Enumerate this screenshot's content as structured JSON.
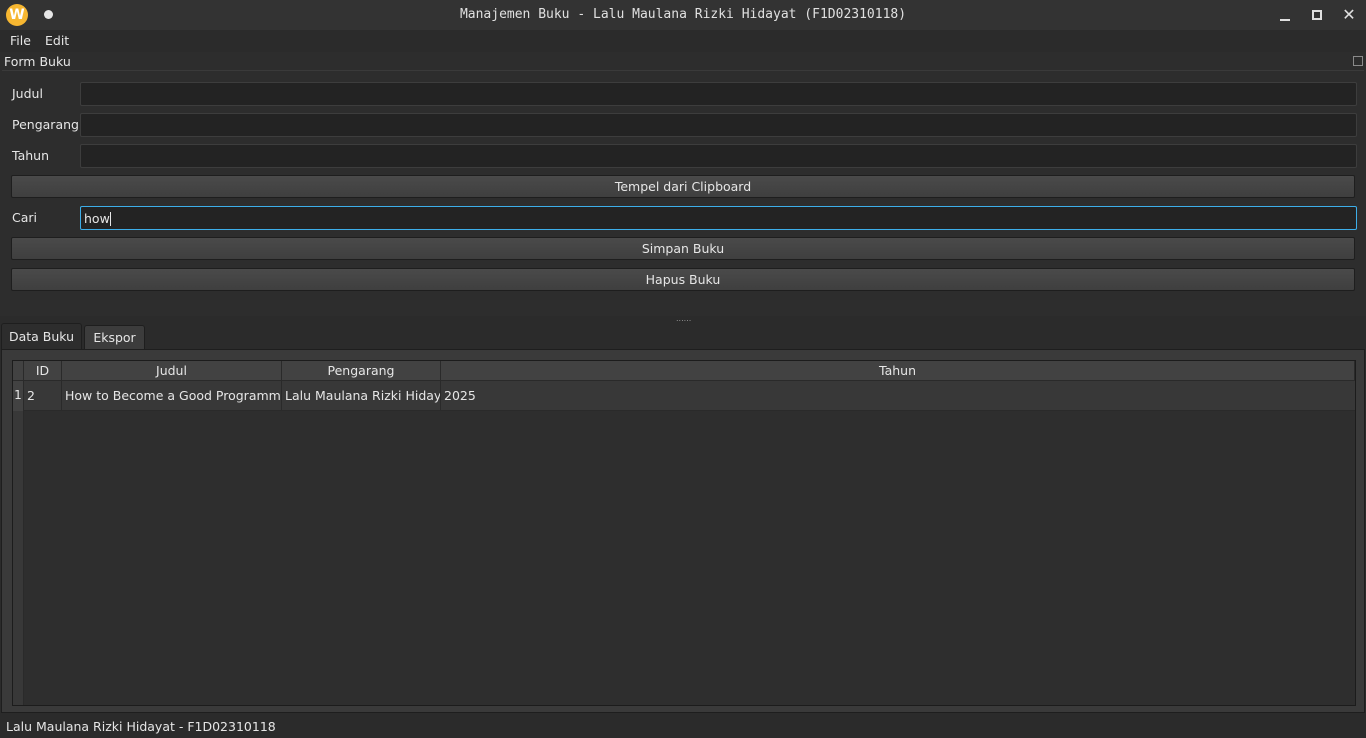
{
  "window": {
    "title": "Manajemen Buku - Lalu Maulana Rizki Hidayat (F1D02310118)",
    "logo_letter": "W",
    "close_glyph": "✕"
  },
  "menu": {
    "file": "File",
    "edit": "Edit"
  },
  "form": {
    "dock_title": "Form Buku",
    "judul_label": "Judul",
    "judul_value": "",
    "pengarang_label": "Pengarang",
    "pengarang_value": "",
    "tahun_label": "Tahun",
    "tahun_value": "",
    "paste_button": "Tempel dari Clipboard",
    "cari_label": "Cari",
    "cari_value": "how",
    "save_button": "Simpan Buku",
    "delete_button": "Hapus Buku"
  },
  "splitter_handle": "......",
  "tabs": {
    "data": "Data Buku",
    "export": "Ekspor"
  },
  "table": {
    "headers": [
      "ID",
      "Judul",
      "Pengarang",
      "Tahun"
    ],
    "rows": [
      {
        "row_number": "1",
        "id": "2",
        "judul": "How to Become a Good Programmer?",
        "pengarang": "Lalu Maulana Rizki Hidayat",
        "tahun": "2025"
      }
    ]
  },
  "status": {
    "text": "Lalu Maulana Rizki Hidayat - F1D02310118"
  },
  "colors": {
    "accent": "#3daee9",
    "background": "#2b2b2b",
    "logo": "#f7b731"
  }
}
